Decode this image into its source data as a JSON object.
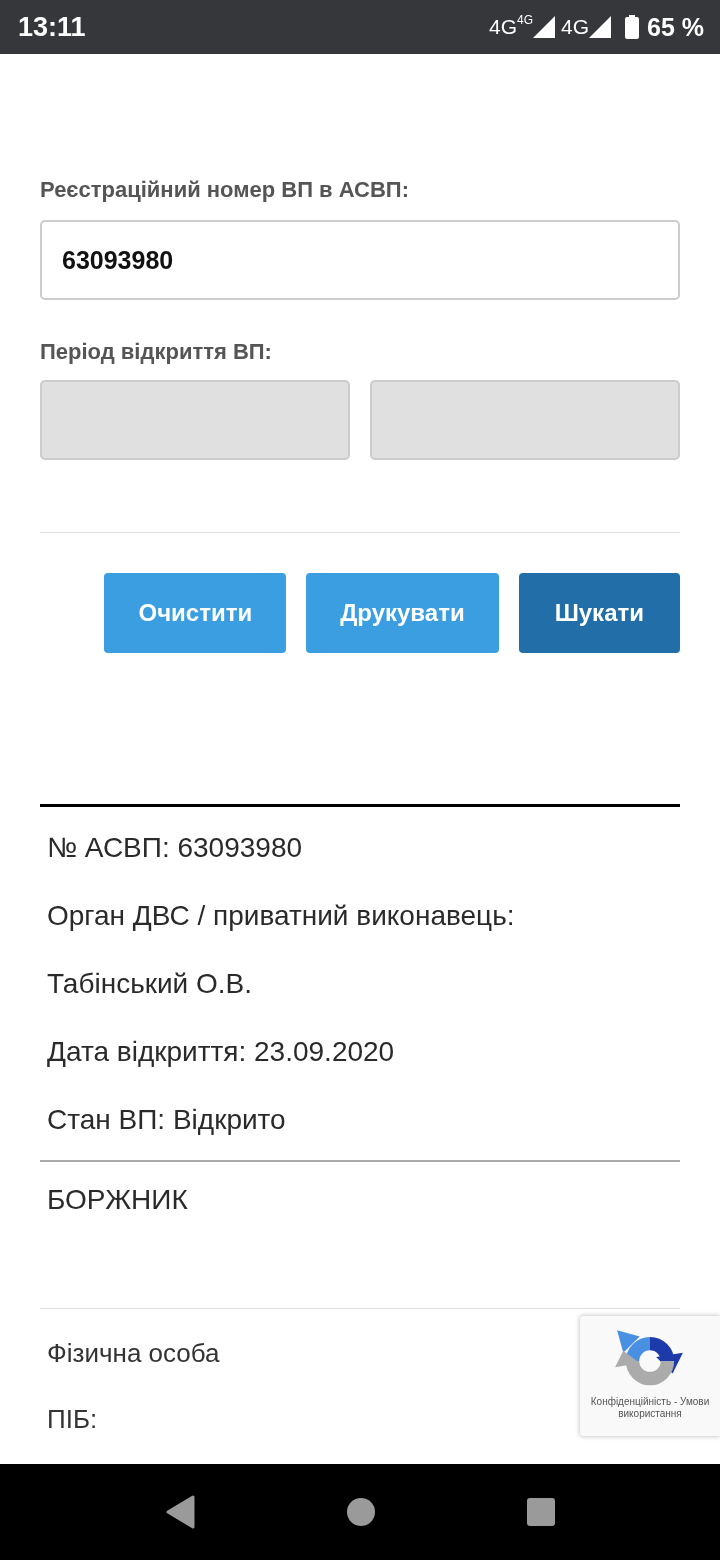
{
  "status_bar": {
    "time": "13:11",
    "network_1": "4G",
    "network_1_sub": "4G",
    "network_2": "4G",
    "battery": "65 %"
  },
  "search_form": {
    "registration_label": "Реєстраційний номер ВП в АСВП:",
    "registration_field": {
      "value": "63093980"
    },
    "period_label": "Період відкриття ВП:",
    "period_fields": [
      {
        "disabled": true
      },
      {
        "disabled": true
      }
    ],
    "buttons": [
      {
        "label": "Очистити",
        "kind": "secondary"
      },
      {
        "label": "Друкувати",
        "kind": "secondary"
      },
      {
        "label": "Шукати",
        "kind": "primary"
      }
    ]
  },
  "result": {
    "lines": [
      "№ АСВП: 63093980",
      "Орган ДВС / приватний виконавець:",
      "Табінський О.В.",
      "Дата відкриття: 23.09.2020",
      "Стан ВП: Відкрито"
    ],
    "section_title": "БОРЖНИК",
    "debtor_type": "Фізична особа",
    "name_label": "ПІБ:"
  },
  "recaptcha": {
    "legal_text": "Конфіденційність - Умови використання"
  }
}
